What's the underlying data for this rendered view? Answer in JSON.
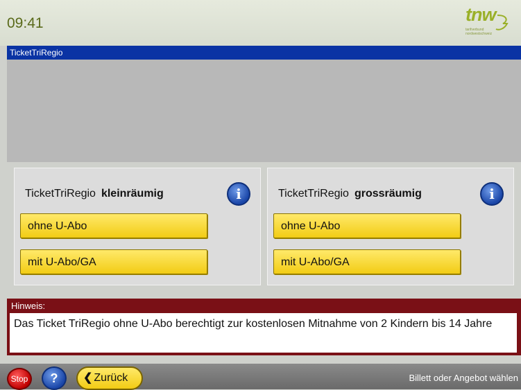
{
  "header": {
    "time": "09:41",
    "logo_text": "tnw",
    "logo_subtext": "tarifverbund nordwestschweiz"
  },
  "title": "TicketTriRegio",
  "panels": [
    {
      "product": "TicketTriRegio",
      "zone": "kleinräumig",
      "info_icon": "info-icon",
      "options": [
        "ohne U-Abo",
        "mit U-Abo/GA"
      ]
    },
    {
      "product": "TicketTriRegio",
      "zone": "grossräumig",
      "info_icon": "info-icon",
      "options": [
        "ohne U-Abo",
        "mit U-Abo/GA"
      ]
    }
  ],
  "hint": {
    "label": "Hinweis:",
    "text": "Das Ticket TriRegio ohne U-Abo berechtigt zur kostenlosen Mitnahme von 2 Kindern bis 14 Jahre"
  },
  "footer": {
    "stop_label": "Stop",
    "help_label": "?",
    "back_chevron": "❮",
    "back_label": "Zurück",
    "status_text": "Billett oder Angebot wählen"
  },
  "colors": {
    "title_bar": "#0a33a4",
    "button_yellow": "#f2cc14",
    "hint_bar": "#7a1016",
    "clock": "#5a6a1a"
  }
}
